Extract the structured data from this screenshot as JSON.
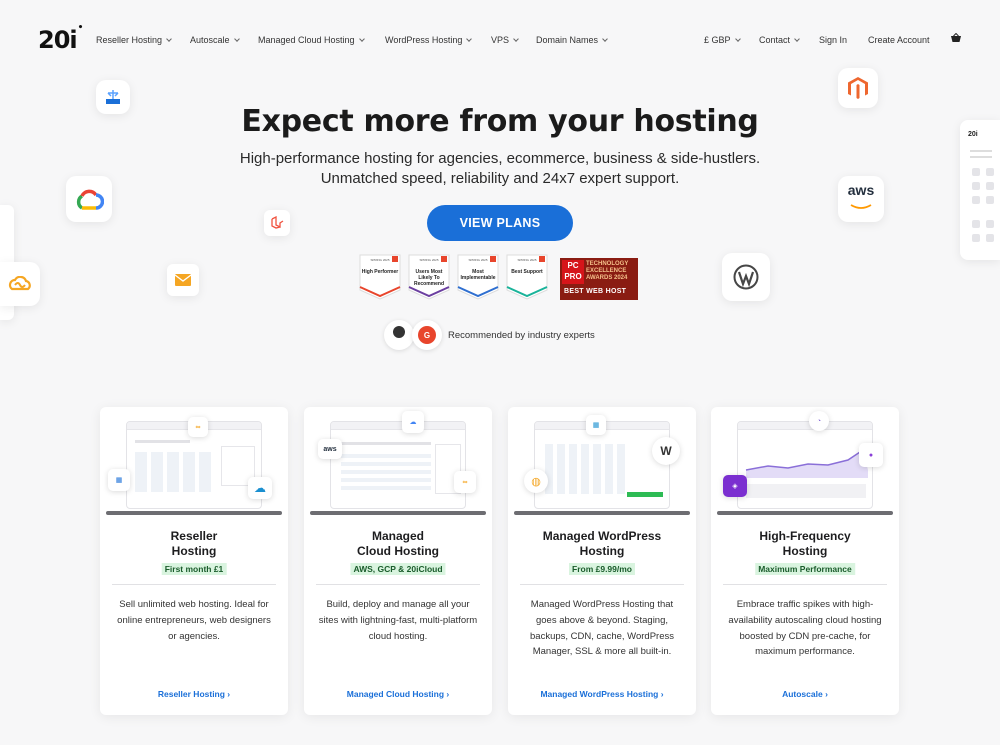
{
  "brand": {
    "logo": "20i"
  },
  "nav": {
    "items": [
      {
        "label": "Reseller Hosting"
      },
      {
        "label": "Autoscale"
      },
      {
        "label": "Managed Cloud Hosting"
      },
      {
        "label": "WordPress Hosting"
      },
      {
        "label": "VPS"
      },
      {
        "label": "Domain Names"
      }
    ],
    "currency": "£ GBP",
    "contact": "Contact",
    "sign_in": "Sign In",
    "create_account": "Create Account"
  },
  "hero": {
    "title": "Expect more from your hosting",
    "subtitle_line1": "High-performance hosting for agencies, ecommerce, business & side-hustlers.",
    "subtitle_line2": "Unmatched speed, reliability and 24x7 expert support.",
    "cta": "VIEW PLANS",
    "recommended": "Recommended by industry experts"
  },
  "badges": [
    {
      "top": "SPRING 2025",
      "label": "High Performer",
      "color": "#e8452c"
    },
    {
      "top": "SPRING 2025",
      "label": "Users Most Likely To Recommend",
      "color": "#6b3fa0"
    },
    {
      "top": "SPRING 2025",
      "label": "Most Implementable",
      "color": "#2f6fd0"
    },
    {
      "top": "SPRING 2025",
      "label": "Best Support",
      "color": "#1ab39a"
    }
  ],
  "award": {
    "pc": "PC",
    "pro": "PRO",
    "line1": "TECHNOLOGY",
    "line2": "EXCELLENCE",
    "line3": "AWARDS 2024",
    "best": "BEST WEB HOST"
  },
  "tiles": {
    "aws": "aws"
  },
  "cards": [
    {
      "title_line1": "Reseller",
      "title_line2": "Hosting",
      "pill": "First month £1",
      "desc": "Sell unlimited web hosting. Ideal for online entrepreneurs, web designers or agencies.",
      "link": "Reseller Hosting ›"
    },
    {
      "title_line1": "Managed",
      "title_line2": "Cloud Hosting",
      "pill": "AWS, GCP & 20iCloud",
      "desc": "Build, deploy and manage all your sites with lightning-fast, multi-platform cloud hosting.",
      "link": "Managed Cloud Hosting ›"
    },
    {
      "title_line1": "Managed WordPress",
      "title_line2": "Hosting",
      "pill": "From £9.99/mo",
      "desc": "Managed WordPress Hosting that goes above & beyond. Staging, backups, CDN, cache, WordPress Manager, SSL & more all built-in.",
      "link": "Managed WordPress Hosting ›"
    },
    {
      "title_line1": "High-Frequency",
      "title_line2": "Hosting",
      "pill": "Maximum Performance",
      "desc": "Embrace traffic spikes with high-availability autoscaling cloud hosting boosted by CDN pre-cache, for maximum performance.",
      "link": "Autoscale ›"
    }
  ],
  "colors": {
    "accent": "#1a6fd8",
    "pill_bg": "#d9f4df",
    "pill_text": "#1a5c2b"
  }
}
